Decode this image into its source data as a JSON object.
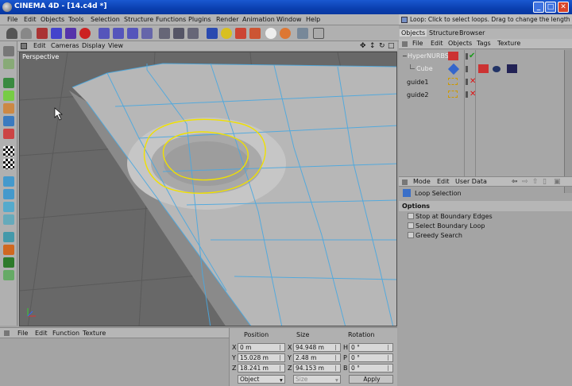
{
  "window": {
    "title": "CINEMA 4D - [14.c4d *]",
    "min": "_",
    "max": "□",
    "close": "✕"
  },
  "menu": [
    "File",
    "Edit",
    "Objects",
    "Tools",
    "Selection",
    "Structure",
    "Functions",
    "Plugins",
    "Render",
    "Animation",
    "Window",
    "Help"
  ],
  "status_message": "Loop: Click to select loops. Drag to change the length of the",
  "viewport": {
    "menu": [
      "Edit",
      "Cameras",
      "Display",
      "View"
    ],
    "label": "Perspective"
  },
  "object_manager": {
    "tabs": [
      "Objects",
      "Structure",
      "Browser"
    ],
    "menu": [
      "File",
      "Edit",
      "Objects",
      "Tags",
      "Texture"
    ],
    "objects": [
      {
        "name": "HyperNURBS"
      },
      {
        "name": "Cube"
      },
      {
        "name": "guide1"
      },
      {
        "name": "guide2"
      }
    ]
  },
  "attributes": {
    "menu": [
      "Mode",
      "Edit",
      "User Data"
    ],
    "tool_name": "Loop Selection",
    "section": "Options",
    "options": [
      "Stop at Boundary Edges",
      "Select Boundary Loop",
      "Greedy Search"
    ]
  },
  "timeline": {
    "menu": [
      "File",
      "Edit",
      "Function",
      "Texture"
    ]
  },
  "coordinates": {
    "headers": [
      "Position",
      "Size",
      "Rotation"
    ],
    "rows": [
      {
        "axis": "X",
        "pos": "0 m",
        "size_axis": "X",
        "size": "94.948 m",
        "rot_axis": "H",
        "rot": "0 °"
      },
      {
        "axis": "Y",
        "pos": "15.028 m",
        "size_axis": "Y",
        "size": "2.48 m",
        "rot_axis": "P",
        "rot": "0 °"
      },
      {
        "axis": "Z",
        "pos": "18.241 m",
        "size_axis": "Z",
        "size": "94.153 m",
        "rot_axis": "B",
        "rot": "0 °"
      }
    ],
    "mode_select": "Object",
    "size_select": "Size",
    "apply_label": "Apply"
  },
  "colors": {
    "selection_loop": "#f0e000",
    "edge_wire": "#4aa8e0",
    "title_bar": "#0a3fb0"
  }
}
